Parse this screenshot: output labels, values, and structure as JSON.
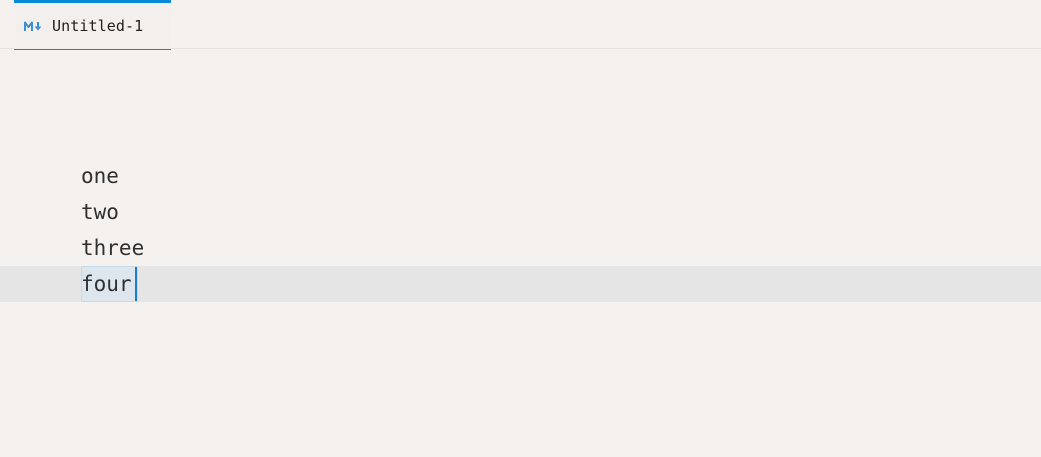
{
  "tab": {
    "label": "Untitled-1",
    "icon": "markdown-icon",
    "accent_color": "#0a8ad6"
  },
  "editor": {
    "lines": [
      "one",
      "two",
      "three",
      "four"
    ],
    "current_line": 4
  }
}
